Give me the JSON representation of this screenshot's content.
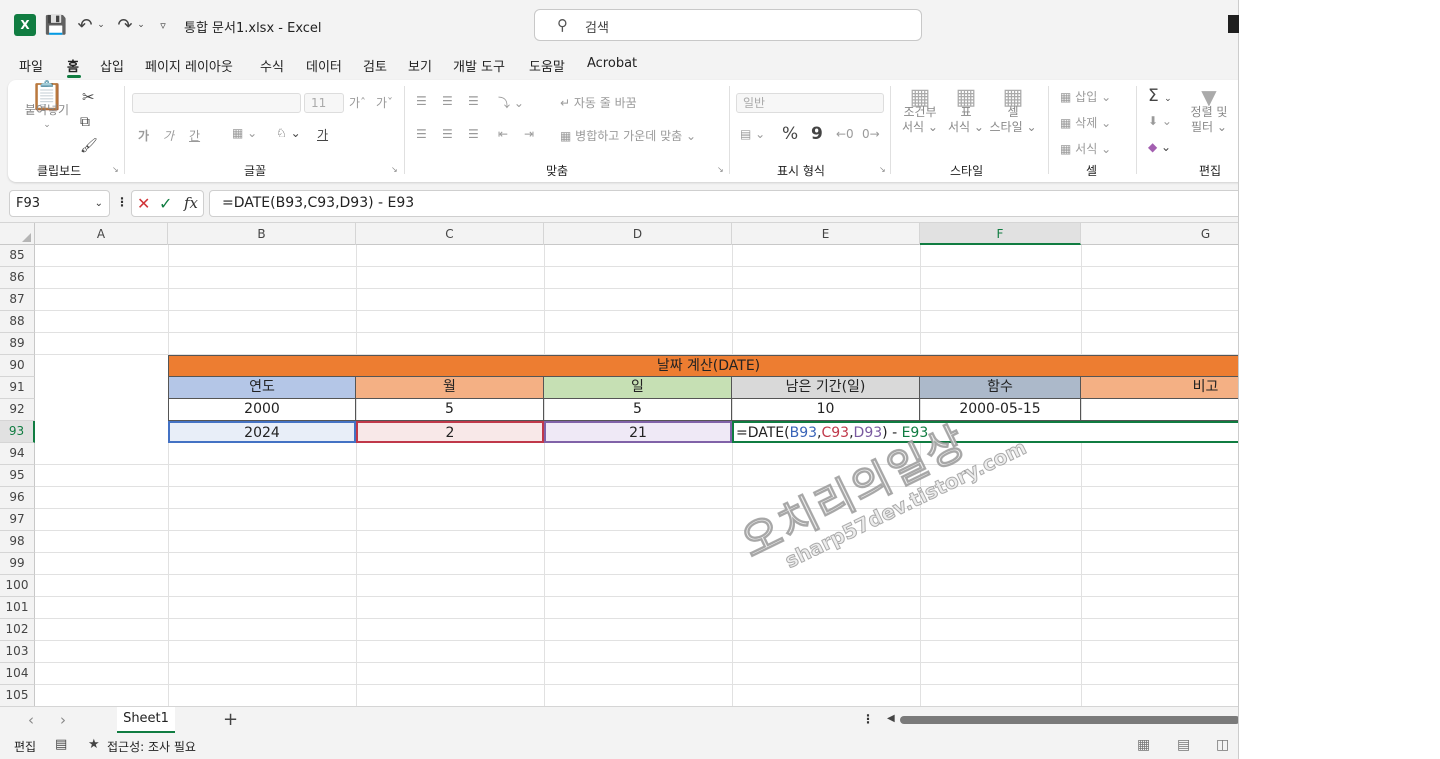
{
  "titlebar": {
    "app_icon": "X",
    "doc_title": "통합 문서1.xlsx  -  Excel",
    "search_placeholder": "검색"
  },
  "menu": {
    "tabs": [
      "파일",
      "홈",
      "삽입",
      "페이지 레이아웃",
      "수식",
      "데이터",
      "검토",
      "보기",
      "개발 도구",
      "도움말",
      "Acrobat"
    ],
    "active_tab": "홈"
  },
  "ribbon": {
    "clipboard": {
      "label": "클립보드",
      "paste": "붙여넣기"
    },
    "font": {
      "label": "글꼴",
      "font_size": "11",
      "bold": "가",
      "italic": "가",
      "underline": "간",
      "grow": "가ˆ",
      "shrink": "가ˇ",
      "color_a": "가"
    },
    "alignment": {
      "label": "맞춤",
      "wrap_text": "자동 줄 바꿈",
      "merge_center": "병합하고 가운데 맞춤"
    },
    "number": {
      "label": "표시 형식",
      "format_value": "일반",
      "percent": "%",
      "comma": "9"
    },
    "styles": {
      "label": "스타일",
      "conditional_1": "조건부",
      "conditional_2": "서식",
      "table_1": "표",
      "table_2": "서식",
      "cell_style_1": "셀",
      "cell_style_2": "스타일"
    },
    "cells": {
      "label": "셀",
      "insert": "삽입",
      "delete": "삭제",
      "format": "서식"
    },
    "editing": {
      "label": "편집",
      "sort_1": "정렬 및",
      "sort_2": "필터"
    }
  },
  "formula_bar": {
    "name_box": "F93",
    "formula": "=DATE(B93,C93,D93) - E93"
  },
  "grid": {
    "columns": [
      "A",
      "B",
      "C",
      "D",
      "E",
      "F",
      "G"
    ],
    "selected_column": "F",
    "rows": [
      "85",
      "86",
      "87",
      "88",
      "89",
      "90",
      "91",
      "92",
      "93",
      "94",
      "95",
      "96",
      "97",
      "98",
      "99",
      "100",
      "101",
      "102",
      "103",
      "104",
      "105"
    ],
    "selected_row": "93",
    "table_title": "날짜 계산(DATE)",
    "headers": [
      "연도",
      "월",
      "일",
      "남은 기간(일)",
      "함수",
      "비고"
    ],
    "header_colors": [
      "#b4c6e7",
      "#f4b084",
      "#c6e0b4",
      "#d9d9d9",
      "#acb9ca",
      "#f4b084"
    ],
    "title_color": "#ed7d31",
    "row92": [
      "2000",
      "5",
      "5",
      "10",
      "2000-05-15",
      ""
    ],
    "row93": [
      "2024",
      "2",
      "21"
    ],
    "edit_tokens": {
      "prefix": "=DATE(",
      "b": "B93",
      "sep1": ",",
      "c": "C93",
      "sep2": ",",
      "d": "D93",
      "mid": ") - ",
      "e": "E93"
    }
  },
  "watermark": {
    "main": "오치리의일상",
    "sub": "sharp57dev.tistory.com"
  },
  "sheets": {
    "tabs": [
      "Sheet1"
    ],
    "active": "Sheet1"
  },
  "status": {
    "mode": "편집",
    "accessibility": "접근성: 조사 필요"
  }
}
